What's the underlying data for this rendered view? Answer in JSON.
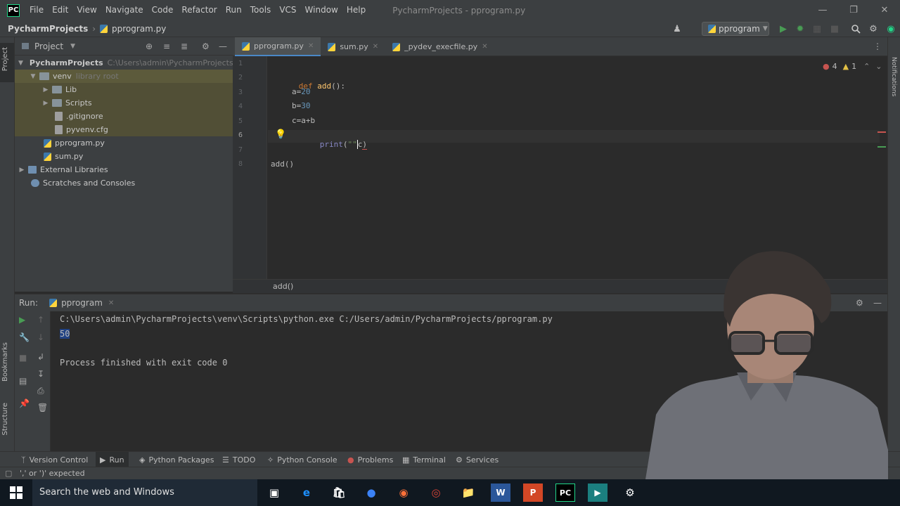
{
  "menubar": {
    "logo": "PC",
    "items": [
      "File",
      "Edit",
      "View",
      "Navigate",
      "Code",
      "Refactor",
      "Run",
      "Tools",
      "VCS",
      "Window",
      "Help"
    ],
    "title": "PycharmProjects - pprogram.py"
  },
  "navbar": {
    "project": "PycharmProjects",
    "file": "pprogram.py",
    "run_config": "pprogram"
  },
  "left_stripe": {
    "project": "Project",
    "bookmarks": "Bookmarks",
    "structure": "Structure"
  },
  "project_panel": {
    "title": "Project",
    "tree": [
      {
        "label": "PycharmProjects",
        "extra": "C:\\Users\\admin\\PycharmProjects"
      },
      {
        "label": "venv",
        "extra": "library root"
      },
      {
        "label": "Lib"
      },
      {
        "label": "Scripts"
      },
      {
        "label": ".gitignore"
      },
      {
        "label": "pyvenv.cfg"
      },
      {
        "label": "pprogram.py"
      },
      {
        "label": "sum.py"
      },
      {
        "label": "External Libraries"
      },
      {
        "label": "Scratches and Consoles"
      }
    ]
  },
  "editor": {
    "tabs": [
      {
        "label": "pprogram.py"
      },
      {
        "label": "sum.py"
      },
      {
        "label": "_pydev_execfile.py"
      }
    ],
    "inspection": {
      "errors": "4",
      "warnings": "1"
    },
    "line_numbers": [
      "1",
      "2",
      "3",
      "4",
      "5",
      "6",
      "7",
      "8"
    ],
    "code": {
      "def": "def",
      "add_def": "add",
      "def_rest": "():",
      "a_assign": "a=",
      "a_val": "20",
      "b_assign": "b=",
      "b_val": "30",
      "c_line": "c=a+b",
      "print": "print",
      "print_open": "(",
      "print_str": "\"\"",
      "print_arg": "c",
      "print_close": ")",
      "call": "add()"
    },
    "breadcrumb": "add()"
  },
  "run_panel": {
    "label": "Run:",
    "tab": "pprogram",
    "command": "C:\\Users\\admin\\PycharmProjects\\venv\\Scripts\\python.exe C:/Users/admin/PycharmProjects/pprogram.py",
    "output": "50",
    "exit": "Process finished with exit code 0"
  },
  "bottom_tools": [
    "Version Control",
    "Run",
    "Python Packages",
    "TODO",
    "Python Console",
    "Problems",
    "Terminal",
    "Services"
  ],
  "statusbar": {
    "message": "',' or ')' expected"
  },
  "taskbar": {
    "search": "Search the web and Windows"
  },
  "right_stripe": {
    "notifications": "Notifications"
  },
  "colors": {
    "accent": "#4a88c7",
    "background": "#2b2b2b",
    "panel": "#3c3f41",
    "run_green": "#499c54",
    "error_red": "#c75450"
  }
}
